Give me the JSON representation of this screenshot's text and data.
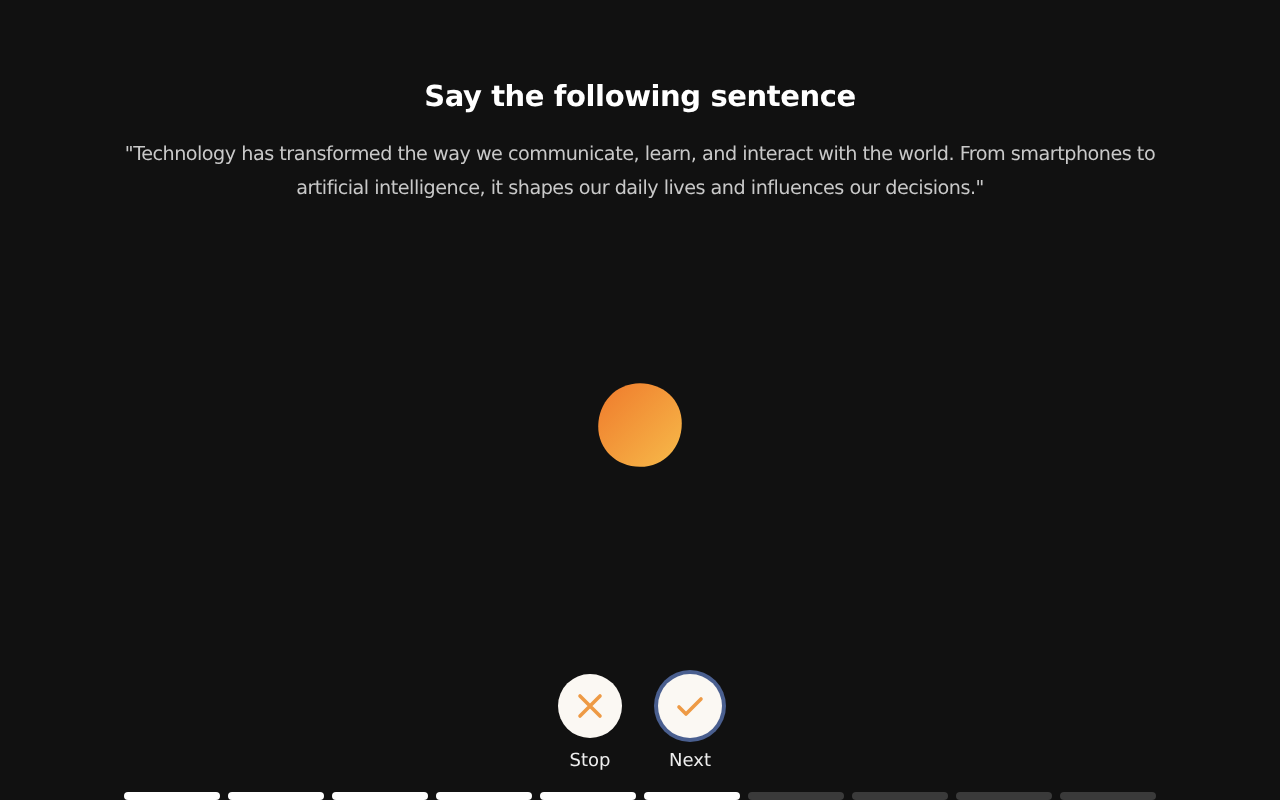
{
  "title": "Say the following sentence",
  "sentence": "\"Technology has transformed the way we communicate, learn, and interact with the world. From smartphones to artificial intelligence, it shapes our daily lives and influences our decisions.\"",
  "controls": [
    {
      "kind": "stop",
      "label": "Stop",
      "focused": false
    },
    {
      "kind": "next",
      "label": "Next",
      "focused": true
    }
  ],
  "progress": [
    {
      "completed": true
    },
    {
      "completed": true
    },
    {
      "completed": true
    },
    {
      "completed": true
    },
    {
      "completed": true
    },
    {
      "completed": true
    },
    {
      "completed": false
    },
    {
      "completed": false
    },
    {
      "completed": false
    },
    {
      "completed": false
    }
  ]
}
